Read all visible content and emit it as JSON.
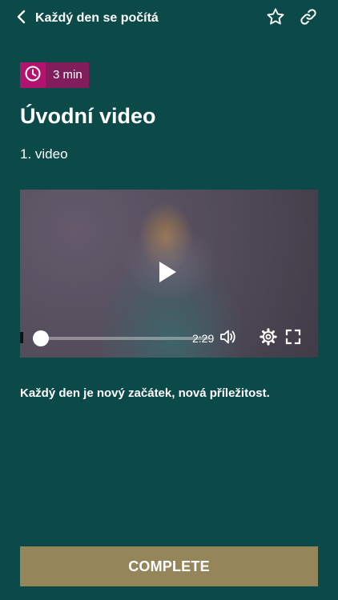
{
  "header": {
    "title": "Každý den se počítá",
    "back_icon": "chevron-left-icon",
    "favorite_icon": "star-outline-icon",
    "share_icon": "link-icon"
  },
  "badge": {
    "icon": "clock-icon",
    "duration": "3 min",
    "icon_bg_color": "#b2136f",
    "text_bg_color": "#821d5b"
  },
  "lesson": {
    "title": "Úvodní video",
    "subtitle": "1. video",
    "description": "Každý den je nový začátek, nová příležitost."
  },
  "video": {
    "play_icon": "play-icon",
    "time_remaining": "2:29",
    "progress_fraction": 0.0,
    "volume_icon": "volume-icon",
    "settings_icon": "gear-icon",
    "fullscreen_icon": "fullscreen-icon"
  },
  "actions": {
    "complete_label": "COMPLETE"
  },
  "colors": {
    "background": "#0b4a49",
    "complete_button": "#94855b"
  }
}
